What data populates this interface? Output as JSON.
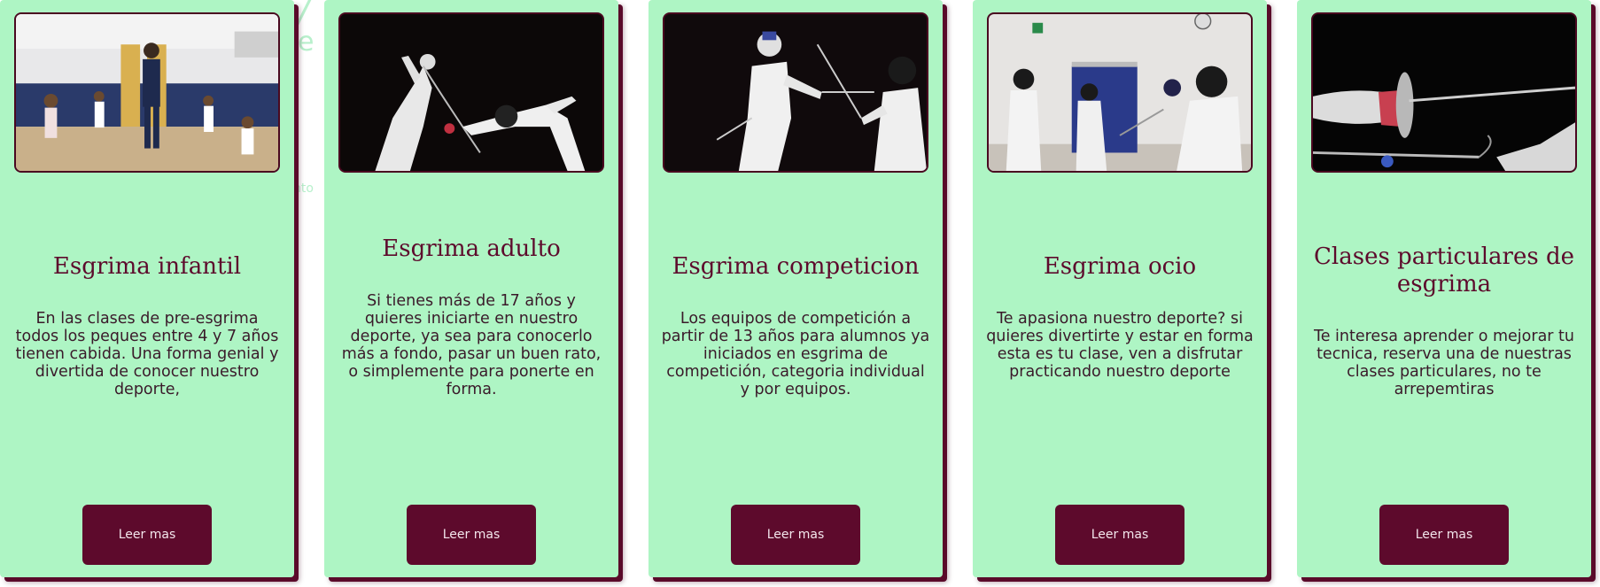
{
  "cards": [
    {
      "title": "Esgrima infantil",
      "text": "En las clases de pre-esgrima todos los peques entre 4 y 7 años tienen cabida. Una forma genial y divertida de conocer nuestro deporte,",
      "button": "Leer mas",
      "image": "children-fencing-class-photo"
    },
    {
      "title": "Esgrima adulto",
      "text": "Si tienes más de 17 años y quieres iniciarte en nuestro deporte, ya sea para conocerlo más a fondo, pasar un buen rato, o simplemente para ponerte en forma.",
      "button": "Leer mas",
      "image": "adult-fencing-lunge-photo"
    },
    {
      "title": "Esgrima competicion",
      "text": "Los equipos de competición a partir de 13 años para alumnos ya iniciados en esgrima de competición, categoria individual y por equipos.",
      "button": "Leer mas",
      "image": "competition-fencers-photo"
    },
    {
      "title": "Esgrima ocio",
      "text": "Te apasiona nuestro deporte? si quieres divertirte y estar en forma esta es tu clase, ven a disfrutar practicando nuestro deporte",
      "button": "Leer mas",
      "image": "leisure-fencing-gym-photo"
    },
    {
      "title": "Clases particulares de esgrima",
      "text": "Te interesa aprender o mejorar tu tecnica, reserva una de nuestras clases particulares, no te arrepemtiras",
      "button": "Leer mas",
      "image": "fencing-blade-closeup-photo"
    }
  ],
  "colors": {
    "card_bg": "#aef5c4",
    "accent": "#5d0a2c",
    "text": "#3a1a2a"
  }
}
